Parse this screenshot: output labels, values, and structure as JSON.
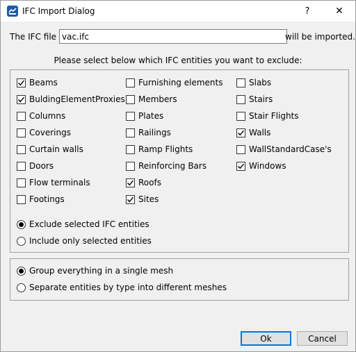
{
  "window": {
    "title": "IFC Import Dialog",
    "help_glyph": "?",
    "close_glyph": "✕"
  },
  "file": {
    "label": "The IFC file",
    "value": "vac.ifc",
    "suffix": "will be imported."
  },
  "instruction": "Please select below which IFC entities you want to exclude:",
  "entities": {
    "col1": [
      {
        "label": "Beams",
        "checked": true
      },
      {
        "label": "BuldingElementProxies",
        "checked": true
      },
      {
        "label": "Columns",
        "checked": false
      },
      {
        "label": "Coverings",
        "checked": false
      },
      {
        "label": "Curtain walls",
        "checked": false
      },
      {
        "label": "Doors",
        "checked": false
      },
      {
        "label": "Flow terminals",
        "checked": false
      },
      {
        "label": "Footings",
        "checked": false
      }
    ],
    "col2": [
      {
        "label": "Furnishing elements",
        "checked": false
      },
      {
        "label": "Members",
        "checked": false
      },
      {
        "label": "Plates",
        "checked": false
      },
      {
        "label": "Railings",
        "checked": false
      },
      {
        "label": "Ramp Flights",
        "checked": false
      },
      {
        "label": "Reinforcing Bars",
        "checked": false
      },
      {
        "label": "Roofs",
        "checked": true
      },
      {
        "label": "Sites",
        "checked": true
      }
    ],
    "col3": [
      {
        "label": "Slabs",
        "checked": false
      },
      {
        "label": "Stairs",
        "checked": false
      },
      {
        "label": "Stair Flights",
        "checked": false
      },
      {
        "label": "Walls",
        "checked": true
      },
      {
        "label": "WallStandardCase's",
        "checked": false
      },
      {
        "label": "Windows",
        "checked": true
      }
    ]
  },
  "mode": {
    "exclude_label": "Exclude selected IFC entities",
    "include_label": "Include only selected entities",
    "selected": "exclude"
  },
  "mesh": {
    "single_label": "Group everything in a single mesh",
    "separate_label": "Separate entities by type into different meshes",
    "selected": "single"
  },
  "buttons": {
    "ok_label": "Ok",
    "cancel_label": "Cancel"
  }
}
